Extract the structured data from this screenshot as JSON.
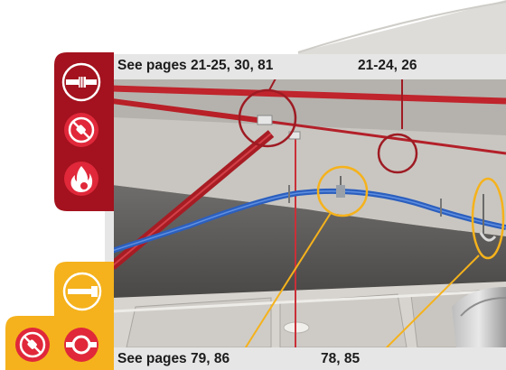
{
  "labels": {
    "top_left": "See pages 21-25, 30, 81",
    "top_right": "21-24, 26",
    "bottom_left": "See pages 79, 86",
    "bottom_right": "78, 85"
  },
  "icons": {
    "red_panel": [
      "pipe-fitting-icon",
      "no-plug-icon",
      "fire-icon"
    ],
    "yellow_panel": [
      "anchor-bolt-icon"
    ],
    "bottom_row": [
      "no-plug-icon",
      "pipe-clamp-icon"
    ]
  },
  "colors": {
    "red_panel": "#a3121e",
    "red_icon": "#e0283a",
    "yellow_panel": "#f5b21c",
    "callout_red": "#9e1b23",
    "callout_yellow": "#f5b21c",
    "sprinkler_pipe": "#c0242c",
    "blue_pipe": "#2c5fbe"
  }
}
